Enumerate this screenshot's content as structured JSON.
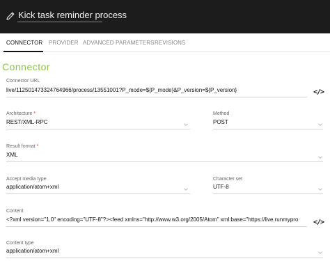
{
  "header": {
    "title": "Kick task reminder process"
  },
  "tabs": [
    {
      "label": "CONNECTOR"
    },
    {
      "label": "PROVIDER"
    },
    {
      "label": "ADVANCED PARAMETERS"
    },
    {
      "label": "REVISIONS"
    }
  ],
  "section": {
    "title": "Connector"
  },
  "connector_url": {
    "label": "Connector URL",
    "value": "live/112501473324764966/process/13551001?P_mode=${P_mode}&P_version=${P_version}"
  },
  "architecture": {
    "label": "Architecture",
    "required_mark": "*",
    "value": "REST/XML-RPC"
  },
  "method": {
    "label": "Method",
    "value": "POST"
  },
  "result_format": {
    "label": "Result format",
    "required_mark": "*",
    "value": "XML"
  },
  "accept_media_type": {
    "label": "Accept media type",
    "value": "application/atom+xml"
  },
  "character_set": {
    "label": "Character set",
    "value": "UTF-8"
  },
  "content": {
    "label": "Content",
    "value": "<?xml version=\"1.0\" encoding=\"UTF-8\"?><feed xmlns=\"http://www.w3.org/2005/Atom\" xml:base=\"https://live.runmypro"
  },
  "content_type": {
    "label": "Content type",
    "value": "application/atom+xml"
  },
  "code_button_glyph": "</>",
  "colors": {
    "header_bg": "#1c1c1c",
    "accent_green": "#8bc34a",
    "required_red": "#d32f2f"
  }
}
